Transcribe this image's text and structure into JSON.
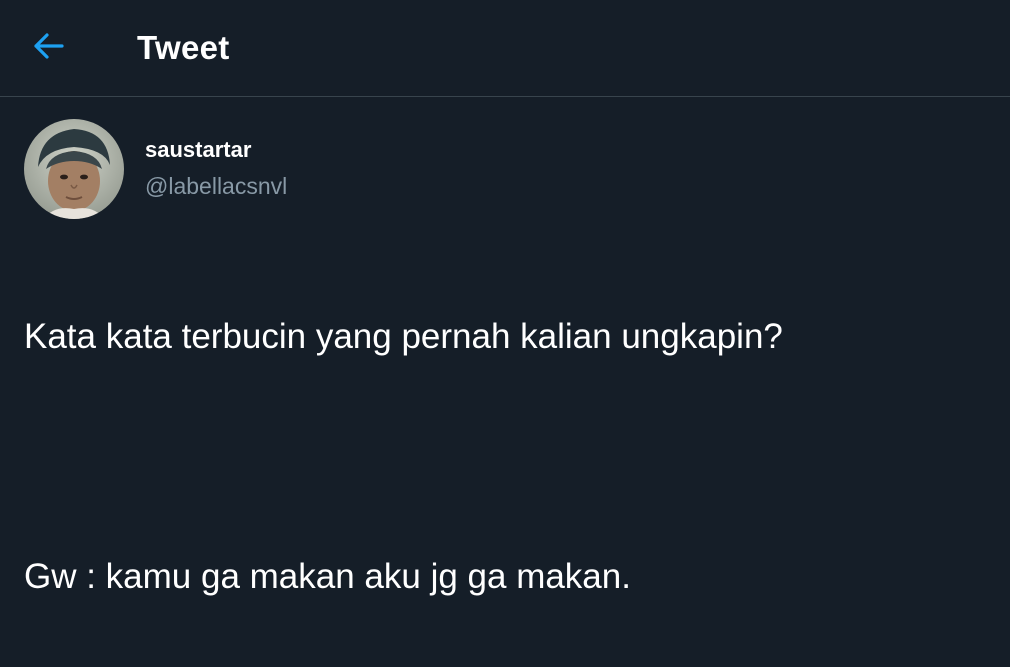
{
  "header": {
    "back_icon": "arrow-left-icon",
    "title": "Tweet",
    "accent_color": "#1da1f2"
  },
  "tweet": {
    "author": {
      "display_name": "saustartar",
      "handle": "@labellacsnvl"
    },
    "text_lines": [
      "Kata kata terbucin yang pernah kalian ungkapin?",
      "Gw : kamu ga makan aku jg ga makan."
    ]
  },
  "colors": {
    "background": "#151e28",
    "secondary_text": "#8899a6",
    "divider": "#38444d"
  }
}
